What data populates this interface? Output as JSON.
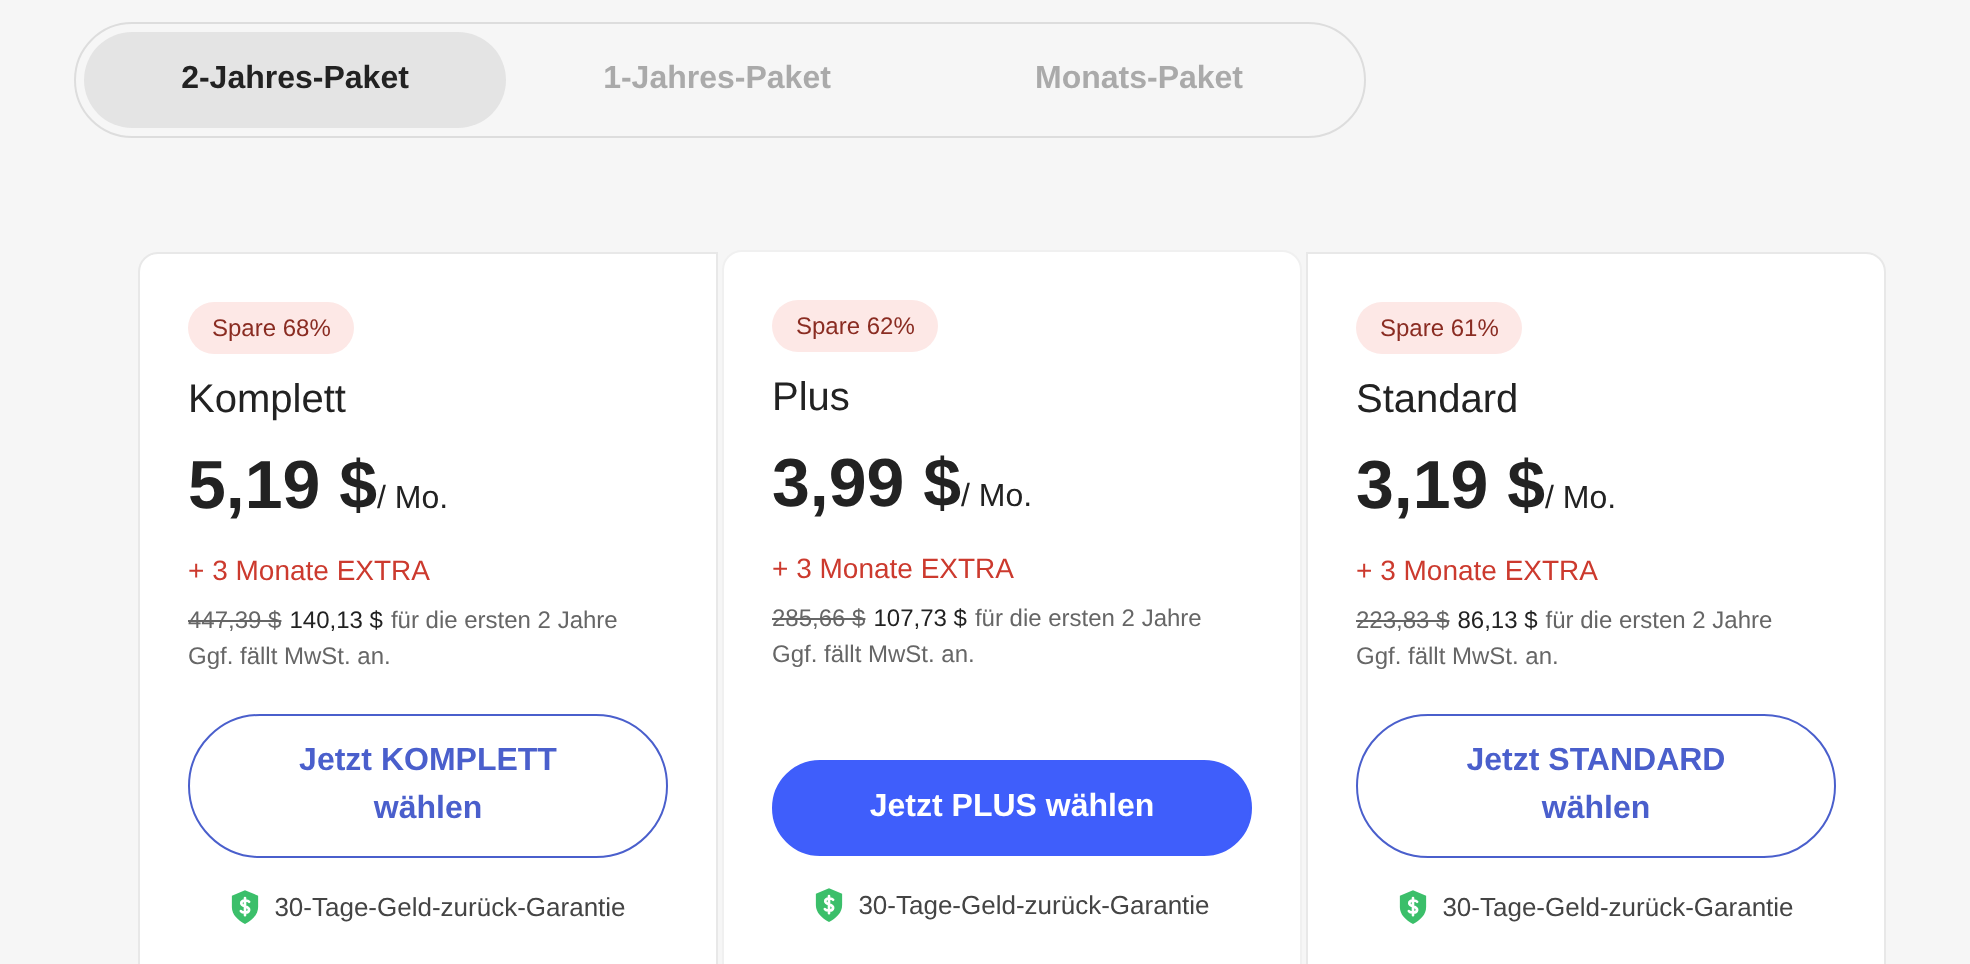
{
  "tabs": [
    {
      "label": "2-Jahres-Paket",
      "selected": true
    },
    {
      "label": "1-Jahres-Paket",
      "selected": false
    },
    {
      "label": "Monats-Paket",
      "selected": false
    }
  ],
  "plans": [
    {
      "badge": "Spare 68%",
      "name": "Komplett",
      "price": "5,19 $",
      "per": "/ Mo.",
      "extra": "+ 3 Monate EXTRA",
      "old_price": "447,39 $",
      "new_price": "140,13 $",
      "period": "für die ersten 2 Jahre",
      "vat": "Ggf. fällt MwSt. an.",
      "button": "Jetzt KOMPLETT wählen",
      "featured": false,
      "guarantee": "30-Tage-Geld-zurück-Garantie"
    },
    {
      "badge": "Spare 62%",
      "name": "Plus",
      "price": "3,99 $",
      "per": "/ Mo.",
      "extra": "+ 3 Monate EXTRA",
      "old_price": "285,66 $",
      "new_price": "107,73 $",
      "period": "für die ersten 2 Jahre",
      "vat": "Ggf. fällt MwSt. an.",
      "button": "Jetzt PLUS wählen",
      "featured": true,
      "guarantee": "30-Tage-Geld-zurück-Garantie"
    },
    {
      "badge": "Spare 61%",
      "name": "Standard",
      "price": "3,19 $",
      "per": "/ Mo.",
      "extra": "+ 3 Monate EXTRA",
      "old_price": "223,83 $",
      "new_price": "86,13 $",
      "period": "für die ersten 2 Jahre",
      "vat": "Ggf. fällt MwSt. an.",
      "button": "Jetzt STANDARD wählen",
      "featured": false,
      "guarantee": "30-Tage-Geld-zurück-Garantie"
    }
  ]
}
